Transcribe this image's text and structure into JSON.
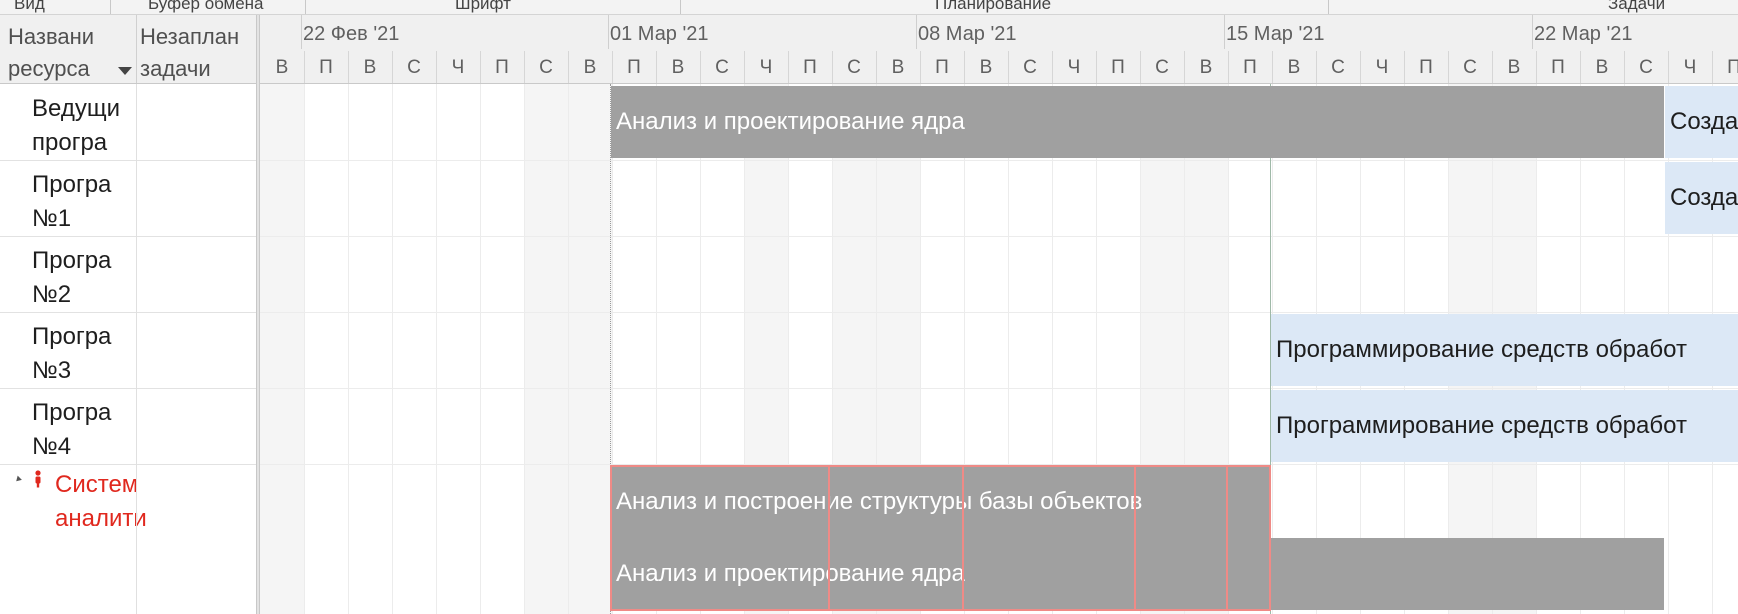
{
  "ribbon": {
    "groups": [
      "Вид",
      "Буфер обмена",
      "Шрифт",
      "Планирование",
      "Задачи"
    ]
  },
  "columns": {
    "name": "Названи ресурса",
    "unscheduled": "Незаплан задачи"
  },
  "resources": [
    {
      "name": "Ведущи програ",
      "overallocated": false
    },
    {
      "name": "Програ №1",
      "overallocated": false
    },
    {
      "name": "Програ №2",
      "overallocated": false
    },
    {
      "name": "Програ №3",
      "overallocated": false
    },
    {
      "name": "Програ №4",
      "overallocated": false
    },
    {
      "name": "Систем аналити",
      "overallocated": true
    }
  ],
  "timescale": {
    "weeks": [
      "22 Фев '21",
      "01 Мар '21",
      "08 Мар '21",
      "15 Мар '21",
      "22 Мар '21"
    ],
    "days": [
      "В",
      "П",
      "В",
      "С",
      "Ч",
      "П",
      "С",
      "В",
      "П",
      "В",
      "С",
      "Ч",
      "П",
      "С",
      "В",
      "П",
      "В",
      "С",
      "Ч",
      "П",
      "С",
      "В",
      "П",
      "В",
      "С",
      "Ч",
      "П",
      "С",
      "В",
      "П",
      "В",
      "С",
      "Ч",
      "П"
    ]
  },
  "bars": [
    {
      "label": "Анализ и проектирование ядра",
      "resource": "Ведущи програ",
      "style": "gray"
    },
    {
      "label": "Создание мо",
      "resource": "Ведущи програ",
      "style": "blue"
    },
    {
      "label": "Создание мо",
      "resource": "Програ №1",
      "style": "blue"
    },
    {
      "label": "Программирование средств обработ",
      "resource": "Програ №3",
      "style": "blue"
    },
    {
      "label": "Программирование средств обработ",
      "resource": "Програ №4",
      "style": "blue"
    },
    {
      "label": "Анализ и построение структуры базы объектов",
      "resource": "Систем аналити",
      "style": "gray"
    },
    {
      "label": "Анализ и проектирование ядра",
      "resource": "Систем аналити",
      "style": "gray"
    }
  ],
  "colors": {
    "assignment_gray": "#a0a0a0",
    "assignment_blue": "#dce8f6",
    "overallocated_text": "#e0281e",
    "overallocation_marker": "#ef8a86"
  }
}
